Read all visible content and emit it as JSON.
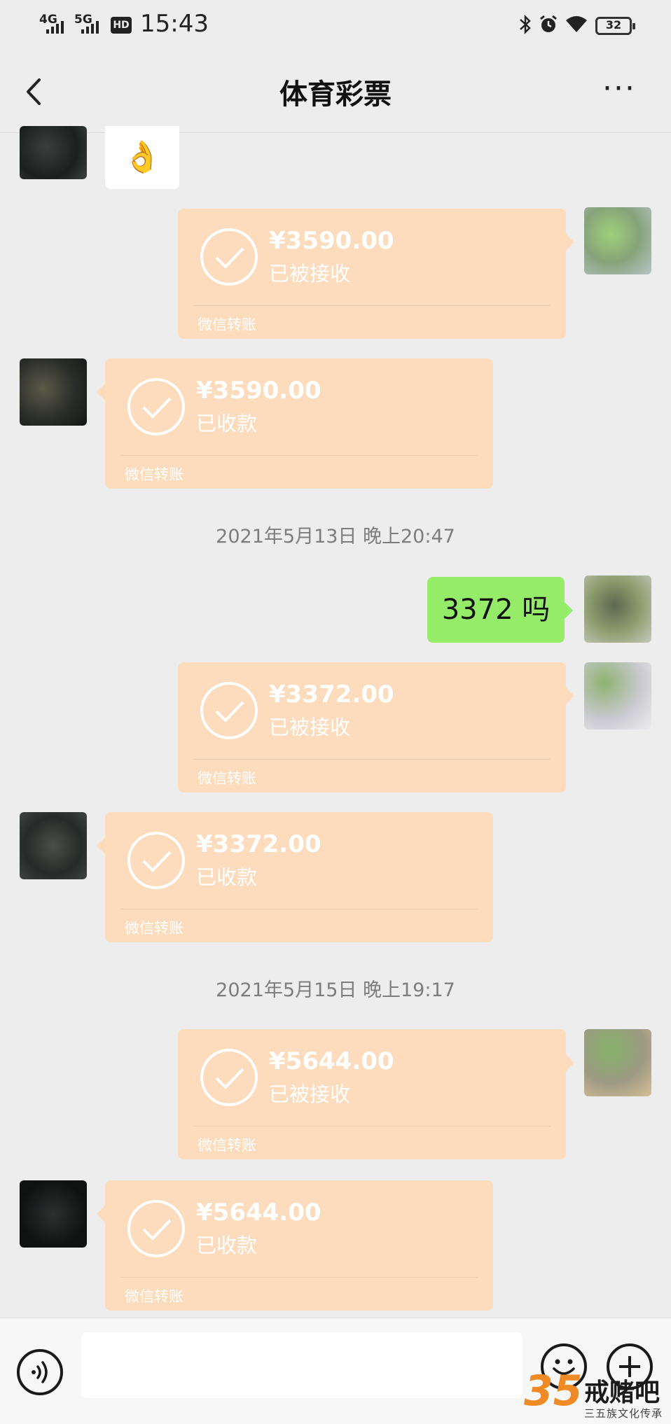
{
  "status_bar": {
    "signal_1": "4G",
    "signal_2": "5G",
    "hd_label": "HD",
    "time": "15:43",
    "battery": "32"
  },
  "header": {
    "title": "体育彩票",
    "more": "···"
  },
  "messages": {
    "sticker": "👌",
    "transfer_1": {
      "amount": "¥3590.00",
      "status": "已被接收",
      "source": "微信转账"
    },
    "transfer_2": {
      "amount": "¥3590.00",
      "status": "已收款",
      "source": "微信转账"
    },
    "timestamp_1": "2021年5月13日 晚上20:47",
    "text_1": "3372 吗",
    "transfer_3": {
      "amount": "¥3372.00",
      "status": "已被接收",
      "source": "微信转账"
    },
    "transfer_4": {
      "amount": "¥3372.00",
      "status": "已收款",
      "source": "微信转账"
    },
    "timestamp_2": "2021年5月15日 晚上19:17",
    "transfer_5": {
      "amount": "¥5644.00",
      "status": "已被接收",
      "source": "微信转账"
    },
    "transfer_6": {
      "amount": "¥5644.00",
      "status": "已收款",
      "source": "微信转账"
    }
  },
  "watermark": {
    "number": "35",
    "name": "戒赌吧",
    "subtitle": "三五族文化传承"
  },
  "colors": {
    "background": "#ededed",
    "transfer_card": "#fcdcbc",
    "my_bubble": "#95ec69",
    "watermark_orange": "#f08a24"
  }
}
